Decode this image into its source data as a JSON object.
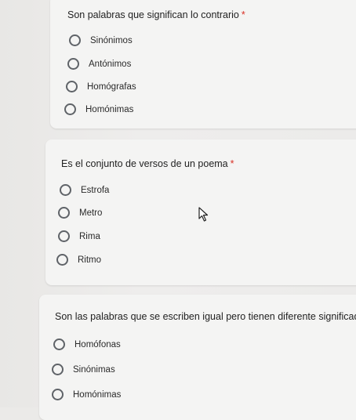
{
  "questions": [
    {
      "title": "Son palabras que significan lo contrario",
      "required": "*",
      "options": [
        "Sinónimos",
        "Antónimos",
        "Homógrafas",
        "Homónimas"
      ]
    },
    {
      "title": "Es el conjunto de versos de un poema",
      "required": "*",
      "options": [
        "Estrofa",
        "Metro",
        "Rima",
        "Ritmo"
      ]
    },
    {
      "title": "Son las palabras que se escriben igual pero tienen diferente significado.",
      "required": "",
      "options": [
        "Homófonas",
        "Sinónimas",
        "Homónimas"
      ]
    }
  ],
  "colors": {
    "required": "#d93025",
    "radio_border": "#5f6368",
    "card_bg": "#f4f4f3"
  },
  "icons": {
    "cursor": "mouse-pointer-icon",
    "radio": "radio-unchecked-icon"
  }
}
